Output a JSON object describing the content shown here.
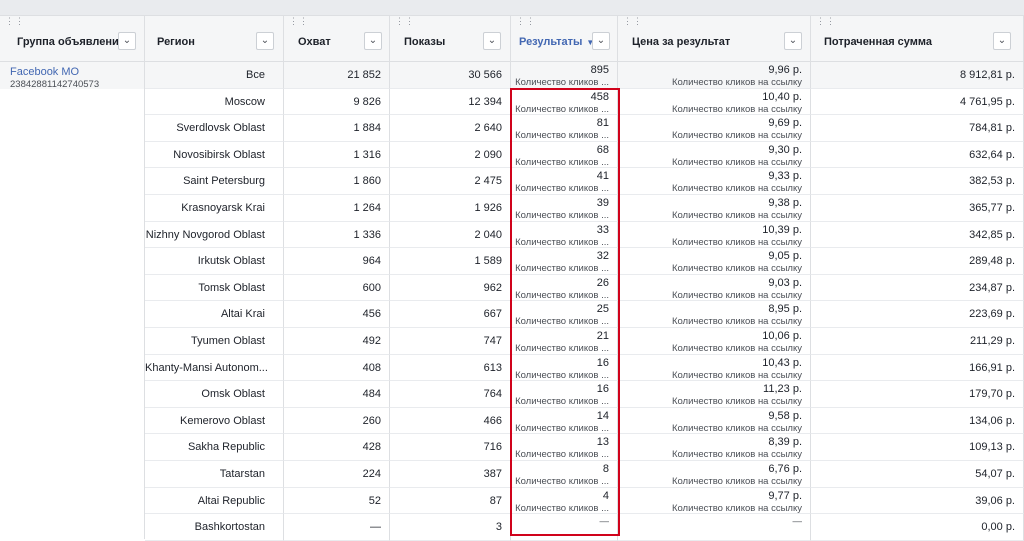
{
  "columns": {
    "adgroup": "Группа объявлений",
    "region": "Регион",
    "reach": "Охват",
    "impressions": "Показы",
    "results": "Результаты",
    "cost": "Цена за результат",
    "spent": "Потраченная сумма"
  },
  "adgroup": {
    "name": "Facebook MO",
    "id": "23842881142740573"
  },
  "totals": {
    "region": "Все",
    "reach": "21 852",
    "impressions": "30 566",
    "results": "895",
    "results_sub": "Количество кликов ...",
    "cost": "9,96 р.",
    "cost_sub": "Количество кликов на ссылку",
    "spent": "8 912,81 р."
  },
  "rows": [
    {
      "region": "Moscow",
      "reach": "9 826",
      "impressions": "12 394",
      "results": "458",
      "results_sub": "Количество кликов ...",
      "cost": "10,40 р.",
      "cost_sub": "Количество кликов на ссылку",
      "spent": "4 761,95 р."
    },
    {
      "region": "Sverdlovsk Oblast",
      "reach": "1 884",
      "impressions": "2 640",
      "results": "81",
      "results_sub": "Количество кликов ...",
      "cost": "9,69 р.",
      "cost_sub": "Количество кликов на ссылку",
      "spent": "784,81 р."
    },
    {
      "region": "Novosibirsk Oblast",
      "reach": "1 316",
      "impressions": "2 090",
      "results": "68",
      "results_sub": "Количество кликов ...",
      "cost": "9,30 р.",
      "cost_sub": "Количество кликов на ссылку",
      "spent": "632,64 р."
    },
    {
      "region": "Saint Petersburg",
      "reach": "1 860",
      "impressions": "2 475",
      "results": "41",
      "results_sub": "Количество кликов ...",
      "cost": "9,33 р.",
      "cost_sub": "Количество кликов на ссылку",
      "spent": "382,53 р."
    },
    {
      "region": "Krasnoyarsk Krai",
      "reach": "1 264",
      "impressions": "1 926",
      "results": "39",
      "results_sub": "Количество кликов ...",
      "cost": "9,38 р.",
      "cost_sub": "Количество кликов на ссылку",
      "spent": "365,77 р."
    },
    {
      "region": "Nizhny Novgorod Oblast",
      "reach": "1 336",
      "impressions": "2 040",
      "results": "33",
      "results_sub": "Количество кликов ...",
      "cost": "10,39 р.",
      "cost_sub": "Количество кликов на ссылку",
      "spent": "342,85 р."
    },
    {
      "region": "Irkutsk Oblast",
      "reach": "964",
      "impressions": "1 589",
      "results": "32",
      "results_sub": "Количество кликов ...",
      "cost": "9,05 р.",
      "cost_sub": "Количество кликов на ссылку",
      "spent": "289,48 р."
    },
    {
      "region": "Tomsk Oblast",
      "reach": "600",
      "impressions": "962",
      "results": "26",
      "results_sub": "Количество кликов ...",
      "cost": "9,03 р.",
      "cost_sub": "Количество кликов на ссылку",
      "spent": "234,87 р."
    },
    {
      "region": "Altai Krai",
      "reach": "456",
      "impressions": "667",
      "results": "25",
      "results_sub": "Количество кликов ...",
      "cost": "8,95 р.",
      "cost_sub": "Количество кликов на ссылку",
      "spent": "223,69 р."
    },
    {
      "region": "Tyumen Oblast",
      "reach": "492",
      "impressions": "747",
      "results": "21",
      "results_sub": "Количество кликов ...",
      "cost": "10,06 р.",
      "cost_sub": "Количество кликов на ссылку",
      "spent": "211,29 р."
    },
    {
      "region": "Khanty-Mansi Autonom...",
      "reach": "408",
      "impressions": "613",
      "results": "16",
      "results_sub": "Количество кликов ...",
      "cost": "10,43 р.",
      "cost_sub": "Количество кликов на ссылку",
      "spent": "166,91 р."
    },
    {
      "region": "Omsk Oblast",
      "reach": "484",
      "impressions": "764",
      "results": "16",
      "results_sub": "Количество кликов ...",
      "cost": "11,23 р.",
      "cost_sub": "Количество кликов на ссылку",
      "spent": "179,70 р."
    },
    {
      "region": "Kemerovo Oblast",
      "reach": "260",
      "impressions": "466",
      "results": "14",
      "results_sub": "Количество кликов ...",
      "cost": "9,58 р.",
      "cost_sub": "Количество кликов на ссылку",
      "spent": "134,06 р."
    },
    {
      "region": "Sakha Republic",
      "reach": "428",
      "impressions": "716",
      "results": "13",
      "results_sub": "Количество кликов ...",
      "cost": "8,39 р.",
      "cost_sub": "Количество кликов на ссылку",
      "spent": "109,13 р."
    },
    {
      "region": "Tatarstan",
      "reach": "224",
      "impressions": "387",
      "results": "8",
      "results_sub": "Количество кликов ...",
      "cost": "6,76 р.",
      "cost_sub": "Количество кликов на ссылку",
      "spent": "54,07 р."
    },
    {
      "region": "Altai Republic",
      "reach": "52",
      "impressions": "87",
      "results": "4",
      "results_sub": "Количество кликов ...",
      "cost": "9,77 р.",
      "cost_sub": "Количество кликов на ссылку",
      "spent": "39,06 р."
    },
    {
      "region": "Bashkortostan",
      "reach": "—",
      "impressions": "3",
      "results": "",
      "results_sub": "—",
      "cost": "",
      "cost_sub": "—",
      "spent": "0,00 р."
    }
  ],
  "colors": {
    "link": "#4267b2",
    "highlight": "#d0021b",
    "header_bg": "#f5f6f7"
  }
}
